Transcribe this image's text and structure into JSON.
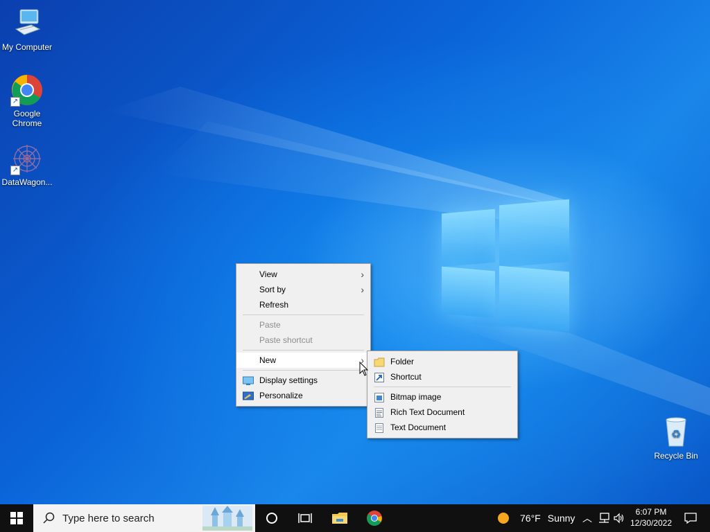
{
  "desktop_icons": [
    {
      "name": "my-computer",
      "label": "My Computer",
      "icon": "computer-icon"
    },
    {
      "name": "google-chrome",
      "label": "Google\nChrome",
      "icon": "chrome-icon"
    },
    {
      "name": "datawagon",
      "label": "DataWagon...",
      "icon": "datawagon-icon"
    },
    {
      "name": "recycle-bin",
      "label": "Recycle Bin",
      "icon": "recycle-bin-icon"
    }
  ],
  "context_menu": {
    "items": [
      {
        "label": "View",
        "submenu": true
      },
      {
        "label": "Sort by",
        "submenu": true
      },
      {
        "label": "Refresh"
      },
      {
        "label": "Paste",
        "disabled": true
      },
      {
        "label": "Paste shortcut",
        "disabled": true
      },
      {
        "label": "New",
        "submenu": true,
        "highlighted": true
      },
      {
        "label": "Display settings",
        "icon": "display-icon"
      },
      {
        "label": "Personalize",
        "icon": "personalize-icon"
      }
    ]
  },
  "new_submenu": {
    "items": [
      {
        "label": "Folder",
        "icon": "folder-icon"
      },
      {
        "label": "Shortcut",
        "icon": "shortcut-icon"
      },
      {
        "label": "Bitmap image",
        "icon": "bitmap-icon"
      },
      {
        "label": "Rich Text Document",
        "icon": "rtf-icon"
      },
      {
        "label": "Text Document",
        "icon": "text-document-icon"
      }
    ]
  },
  "taskbar": {
    "search_placeholder": "Type here to search",
    "weather_temp": "76°F",
    "weather_condition": "Sunny",
    "time": "6:07 PM",
    "date": "12/30/2022"
  },
  "colors": {
    "taskbar": "#101010",
    "menu_bg": "#f0f0f0",
    "accent_blue": "#0a64d8"
  }
}
